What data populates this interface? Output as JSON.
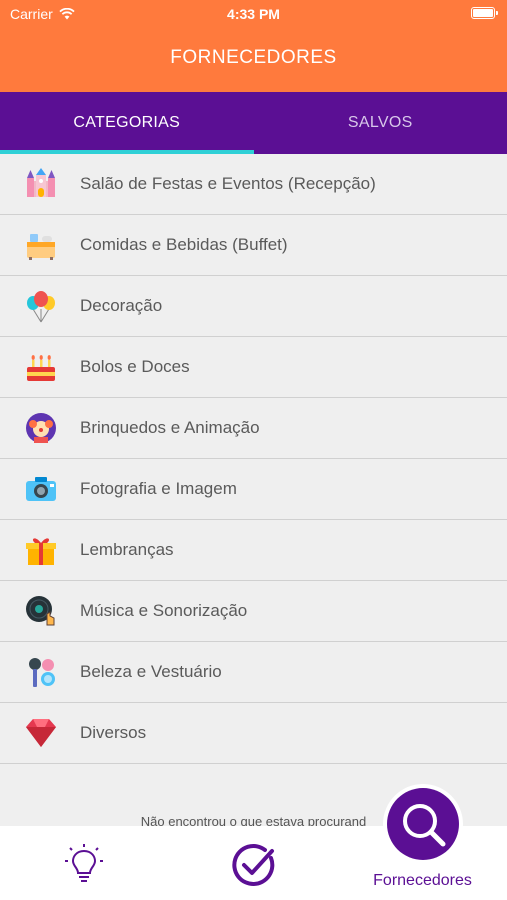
{
  "status_bar": {
    "carrier": "Carrier",
    "time": "4:33 PM"
  },
  "header": {
    "title": "FORNECEDORES"
  },
  "tabs": [
    {
      "label": "CATEGORIAS",
      "active": true
    },
    {
      "label": "SALVOS",
      "active": false
    }
  ],
  "categories": [
    {
      "label": "Salão de Festas e Eventos (Recepção)",
      "icon": "castle-icon"
    },
    {
      "label": "Comidas e Bebidas (Buffet)",
      "icon": "buffet-icon"
    },
    {
      "label": "Decoração",
      "icon": "balloons-icon"
    },
    {
      "label": "Bolos e Doces",
      "icon": "cake-icon"
    },
    {
      "label": "Brinquedos e Animação",
      "icon": "clown-icon"
    },
    {
      "label": "Fotografia e Imagem",
      "icon": "camera-icon"
    },
    {
      "label": "Lembranças",
      "icon": "gift-icon"
    },
    {
      "label": "Música e Sonorização",
      "icon": "vinyl-record-icon"
    },
    {
      "label": "Beleza e Vestuário",
      "icon": "makeup-icon"
    },
    {
      "label": "Diversos",
      "icon": "diamond-icon"
    }
  ],
  "footer": {
    "text": "Não encontrou o que estava procurand"
  },
  "tabbar": {
    "items": [
      {
        "icon": "lightbulb-icon"
      },
      {
        "icon": "checkmark-icon"
      },
      {
        "icon": "search-icon",
        "label": "Fornecedores"
      }
    ]
  },
  "colors": {
    "header": "#ff7a3d",
    "tabs": "#5b0f94",
    "tab_indicator": "#2fd0d6",
    "accent": "#5b0f94"
  }
}
